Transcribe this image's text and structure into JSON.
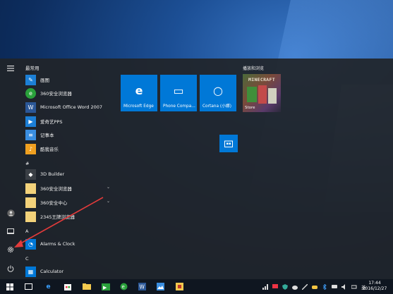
{
  "start_menu": {
    "most_used_header": "最常用",
    "most_used": [
      {
        "label": "画图",
        "icon": "paint-icon",
        "color": "#1c7fd6"
      },
      {
        "label": "360安全浏览器",
        "icon": "360-browser-icon",
        "color": "#2aa13b"
      },
      {
        "label": "Microsoft Office Word 2007",
        "icon": "word-icon",
        "color": "#2b5797"
      },
      {
        "label": "爱奇艺PPS",
        "icon": "iqiyi-icon",
        "color": "#1c7fd6"
      },
      {
        "label": "记事本",
        "icon": "notepad-icon",
        "color": "#3a8ee0"
      },
      {
        "label": "酷我音乐",
        "icon": "kuwo-icon",
        "color": "#f0a020"
      }
    ],
    "sections": [
      {
        "letter": "#",
        "items": [
          {
            "label": "3D Builder",
            "icon": "3d-builder-icon",
            "color": "#3a3f45",
            "expandable": false
          },
          {
            "label": "360安全浏览器",
            "icon": "folder-icon",
            "color": "#f3d27a",
            "expandable": true
          },
          {
            "label": "360安全中心",
            "icon": "folder-icon",
            "color": "#f3d27a",
            "expandable": true
          },
          {
            "label": "2345王牌浏览器",
            "icon": "browser-2345-icon",
            "color": "#f3d27a",
            "expandable": false
          }
        ]
      },
      {
        "letter": "A",
        "items": [
          {
            "label": "Alarms & Clock",
            "icon": "alarm-clock-icon",
            "color": "#0078d7",
            "expandable": false
          }
        ]
      },
      {
        "letter": "C",
        "items": [
          {
            "label": "Calculator",
            "icon": "calculator-icon",
            "color": "#0078d7",
            "expandable": false
          }
        ]
      }
    ],
    "tiles": [
      {
        "label": "Microsoft Edge",
        "glyph": "e"
      },
      {
        "label": "Phone Compa...",
        "glyph": "▭"
      },
      {
        "label": "Cortana (小娜)",
        "glyph": "○"
      }
    ],
    "play_group_title": "播放和浏览",
    "game_tile": {
      "title": "MINECRAFT",
      "label": "Store"
    }
  },
  "taskbar": {
    "tray_lang": "英",
    "clock_time": "17:44",
    "clock_date": "2016/12/27"
  },
  "colors": {
    "accent": "#0078d7",
    "arrow": "#e23b3b"
  }
}
